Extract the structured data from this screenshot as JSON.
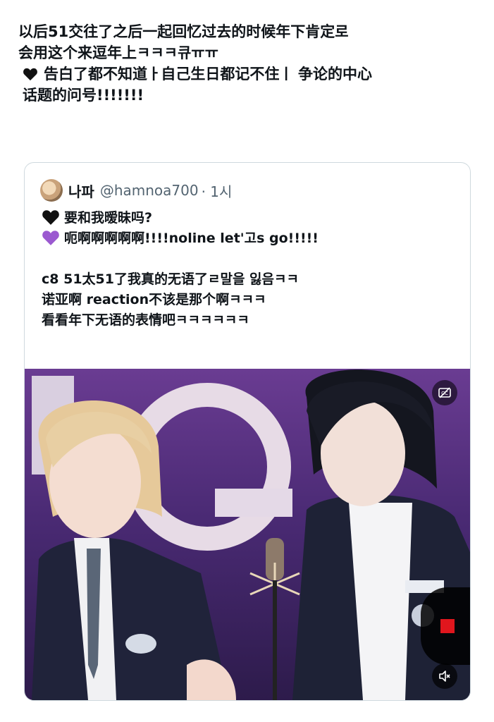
{
  "post": {
    "line1": "以后51交往了之后一起回忆过去的时候年下肯定로",
    "line2": "会用这个来逗年上ㅋㅋㅋ큐ㅠㅠ",
    "line3": "告白了都不知道ㅏ自己生日都记不住ㅣ 争论的中心",
    "line4": "话题的问号!!!!!!!"
  },
  "quote": {
    "name": "나파",
    "handle": "@hamnoa700",
    "time": "· 1시",
    "line1": "要和我暧昧吗?",
    "line2": "呃啊啊啊啊啊!!!!noline let'고s go!!!!!",
    "line3": "c8 51太51了我真的无语了ㄹ말을 잃음ㅋㅋ",
    "line4": "诺亚啊 reaction不该是那个啊ㅋㅋㅋ",
    "line5": "看看年下无语的表情吧ㅋㅋㅋㅋㅋㅋ"
  },
  "icons": {
    "black_heart": "black-heart-emoji",
    "purple_heart": "purple-heart-emoji",
    "captions": "cc-icon",
    "mute": "speaker-muted-icon",
    "record": "record-stop-icon"
  },
  "colors": {
    "text": "#0f1419",
    "secondary": "#536471",
    "border": "#cfd9de",
    "purple_heart": "#9b59d0",
    "record": "#e0161d"
  }
}
